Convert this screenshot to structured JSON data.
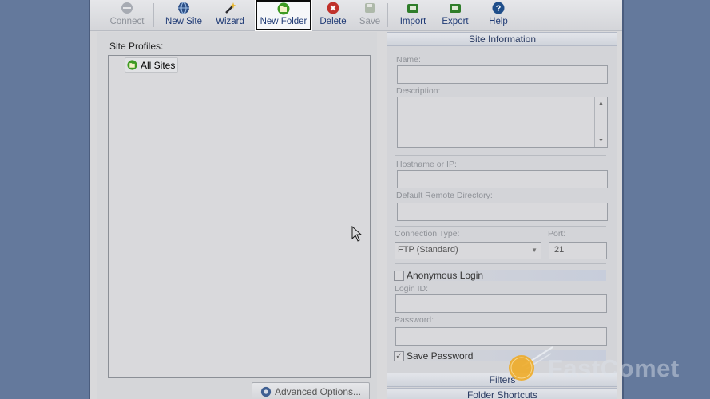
{
  "toolbar": {
    "buttons": [
      {
        "label": "Connect",
        "icon": "connect-icon",
        "enabled": false
      },
      {
        "label": "New Site",
        "icon": "globe-icon",
        "enabled": true
      },
      {
        "label": "Wizard",
        "icon": "wand-icon",
        "enabled": true
      },
      {
        "label": "New Folder",
        "icon": "folder-icon",
        "enabled": true,
        "highlighted": true
      },
      {
        "label": "Delete",
        "icon": "delete-icon",
        "enabled": true
      },
      {
        "label": "Save",
        "icon": "save-icon",
        "enabled": false
      },
      {
        "label": "Import",
        "icon": "import-icon",
        "enabled": true
      },
      {
        "label": "Export",
        "icon": "export-icon",
        "enabled": true
      },
      {
        "label": "Help",
        "icon": "help-icon",
        "enabled": true
      }
    ]
  },
  "left_panel": {
    "site_profiles_label": "Site Profiles:",
    "tree_root_label": "All Sites",
    "advanced_options_label": "Advanced Options..."
  },
  "right_panel": {
    "site_info_header": "Site Information",
    "name_label": "Name:",
    "name_value": "",
    "description_label": "Description:",
    "description_value": "",
    "hostname_label": "Hostname or IP:",
    "hostname_value": "",
    "remote_dir_label": "Default Remote Directory:",
    "remote_dir_value": "",
    "connection_type_label": "Connection Type:",
    "connection_type_value": "FTP (Standard)",
    "port_label": "Port:",
    "port_value": "21",
    "anonymous_login_label": "Anonymous Login",
    "anonymous_login_checked": false,
    "login_id_label": "Login ID:",
    "login_id_value": "",
    "password_label": "Password:",
    "password_value": "",
    "save_password_label": "Save Password",
    "save_password_checked": true,
    "filters_header": "Filters",
    "folder_shortcuts_header": "Folder Shortcuts"
  },
  "watermark": {
    "text": "FastComet"
  },
  "colors": {
    "background": "#64799c",
    "window": "#d9d9db",
    "toolbar_text": "#1f3a75",
    "delete_red": "#c0312b",
    "help_blue": "#1f4e8a",
    "folder_green": "#2f8b1e",
    "watermark_orange": "#f0a81c"
  }
}
